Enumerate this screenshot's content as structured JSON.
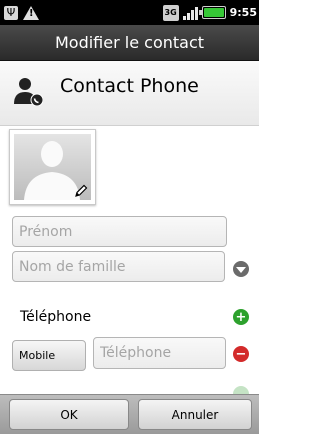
{
  "status_bar": {
    "icons_left": [
      "usb-icon",
      "warning-icon"
    ],
    "network_label": "3G",
    "time": "9:55"
  },
  "title": "Modifier le contact",
  "header": {
    "account_name": "Contact Phone",
    "icon": "contact-phone-icon"
  },
  "form": {
    "photo_icon": "photo-placeholder",
    "first_name_placeholder": "Prénom",
    "last_name_placeholder": "Nom de famille",
    "phone_section_label": "Téléphone",
    "phone_type": "Mobile",
    "phone_placeholder": "Téléphone"
  },
  "buttons": {
    "ok": "OK",
    "cancel": "Annuler"
  },
  "colors": {
    "add": "#2da12d",
    "remove": "#d32a2a",
    "expand": "#6b6b6b"
  }
}
